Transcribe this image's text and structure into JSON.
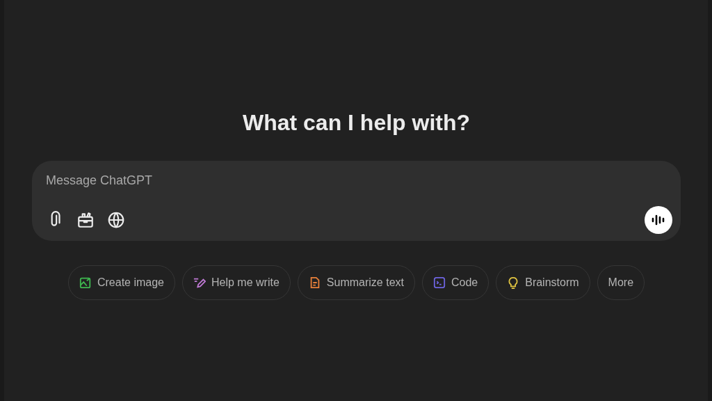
{
  "heading": "What can I help with?",
  "composer": {
    "placeholder": "Message ChatGPT"
  },
  "suggestions": [
    {
      "label": "Create image",
      "kind": "image",
      "color": "#3fb950"
    },
    {
      "label": "Help me write",
      "kind": "write",
      "color": "#c07ad6"
    },
    {
      "label": "Summarize text",
      "kind": "summary",
      "color": "#e8803a"
    },
    {
      "label": "Code",
      "kind": "code",
      "color": "#6e64e0"
    },
    {
      "label": "Brainstorm",
      "kind": "idea",
      "color": "#e2c541"
    },
    {
      "label": "More"
    }
  ]
}
